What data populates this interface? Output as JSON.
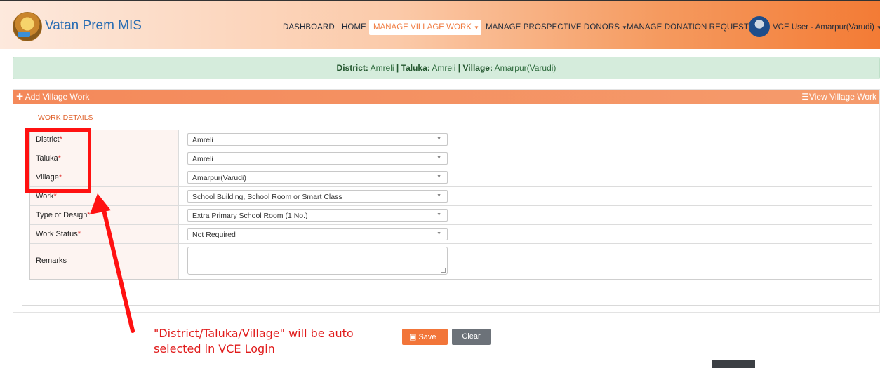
{
  "header": {
    "brand": "Vatan Prem MIS",
    "menu": {
      "dashboard": "DASHBOARD",
      "home": "HOME",
      "manage_village_work": "MANAGE VILLAGE WORK",
      "manage_prospective_donors": "MANAGE PROSPECTIVE DONORS",
      "manage_donation_request": "MANAGE DONATION REQUEST"
    },
    "user": "VCE User - Amarpur(Varudi)"
  },
  "location_bar": {
    "district_label": "District:",
    "district_value": "Amreli",
    "taluka_label": "Taluka:",
    "taluka_value": "Amreli",
    "village_label": "Village:",
    "village_value": "Amarpur(Varudi)",
    "separator": "|"
  },
  "panel": {
    "title": "Add Village Work",
    "view_link": "View Village Work",
    "legend": "WORK DETAILS"
  },
  "form": {
    "rows": [
      {
        "label": "District",
        "value": "Amreli"
      },
      {
        "label": "Taluka",
        "value": "Amreli"
      },
      {
        "label": "Village",
        "value": "Amarpur(Varudi)"
      },
      {
        "label": "Work",
        "value": "School Building, School Room or Smart Class"
      },
      {
        "label": "Type of Design",
        "value": "Extra Primary School Room (1 No.)"
      },
      {
        "label": "Work Status",
        "value": "Not Required"
      }
    ],
    "remarks_label": "Remarks",
    "required_mark": "*"
  },
  "buttons": {
    "save": "Save",
    "clear": "Clear"
  },
  "annotation": {
    "line1": "\"District/Taluka/Village\" will be auto",
    "line2": "selected in VCE Login",
    "color": "#e01b1b"
  },
  "colors": {
    "accent": "#f27539",
    "info_bg": "#d5ecdc"
  }
}
